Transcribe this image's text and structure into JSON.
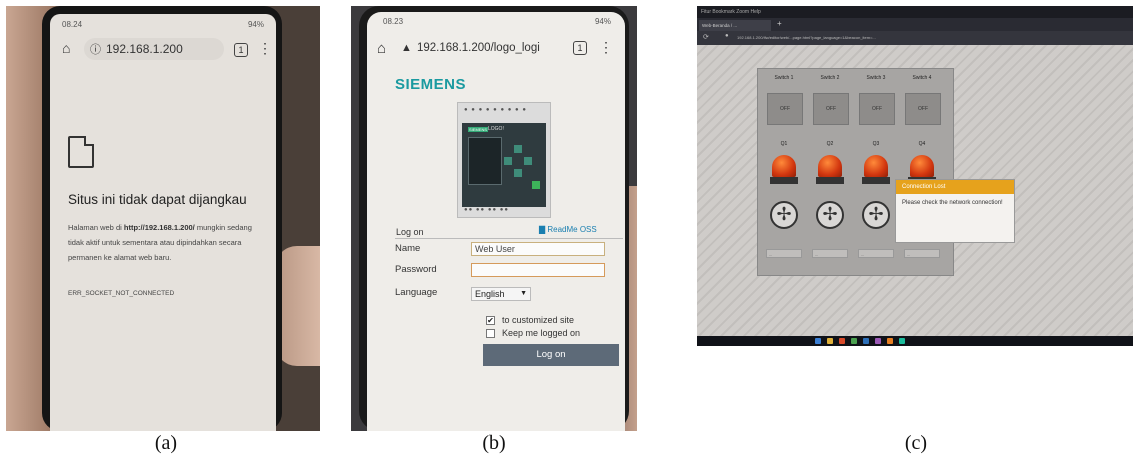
{
  "captions": {
    "a": "(a)",
    "b": "(b)",
    "c": "(c)"
  },
  "panel_a": {
    "status_time": "08.24",
    "status_right": "94%",
    "url": "192.168.1.200",
    "tab_count": "1",
    "menu_icon": "⋮",
    "error_title": "Situs ini tidak dapat dijangkau",
    "error_body_prefix": "Halaman web di ",
    "error_body_url": "http://192.168.1.200/",
    "error_body_suffix": " mungkin sedang tidak aktif untuk sementara atau dipindahkan secara permanen ke alamat web baru.",
    "error_code": "ERR_SOCKET_NOT_CONNECTED"
  },
  "panel_b": {
    "status_time": "08.23",
    "status_right": "94%",
    "url": "192.168.1.200/logo_logi",
    "tab_count": "1",
    "menu_icon": "⋮",
    "brand": "SIEMENS",
    "plc_brand": "SIEMENS",
    "plc_model": "LOGO!",
    "log_on_heading": "Log on",
    "readme": "ReadMe OSS",
    "name_label": "Name",
    "name_value": "Web User",
    "password_label": "Password",
    "password_value": "",
    "language_label": "Language",
    "language_value": "English",
    "customized_label": "to customized site",
    "customized_checked": "✔",
    "keep_logged_label": "Keep me logged on",
    "logon_button": "Log on"
  },
  "panel_c": {
    "menubar": "Fitur  Bookmark  Zoom  Help",
    "tab_label": "Web-Beranda / ...",
    "newtab": "+",
    "url": "192.168.1.200/lfw/editor/web/...page.html?page_language=1&beacon_item=...",
    "switches": [
      "Switch 1",
      "Switch 2",
      "Switch 3",
      "Switch 4"
    ],
    "switch_states": [
      "OFF",
      "OFF",
      "OFF",
      "OFF"
    ],
    "outputs": [
      "Q1",
      "Q2",
      "Q3",
      "Q4"
    ],
    "dropdowns": [
      "...",
      "...",
      "...",
      "..."
    ],
    "dialog_title": "Connection Lost",
    "dialog_message": "Please check the network connection!",
    "colors": {
      "dialog_header": "#e6a21c",
      "lamp": "#d2360f"
    }
  }
}
